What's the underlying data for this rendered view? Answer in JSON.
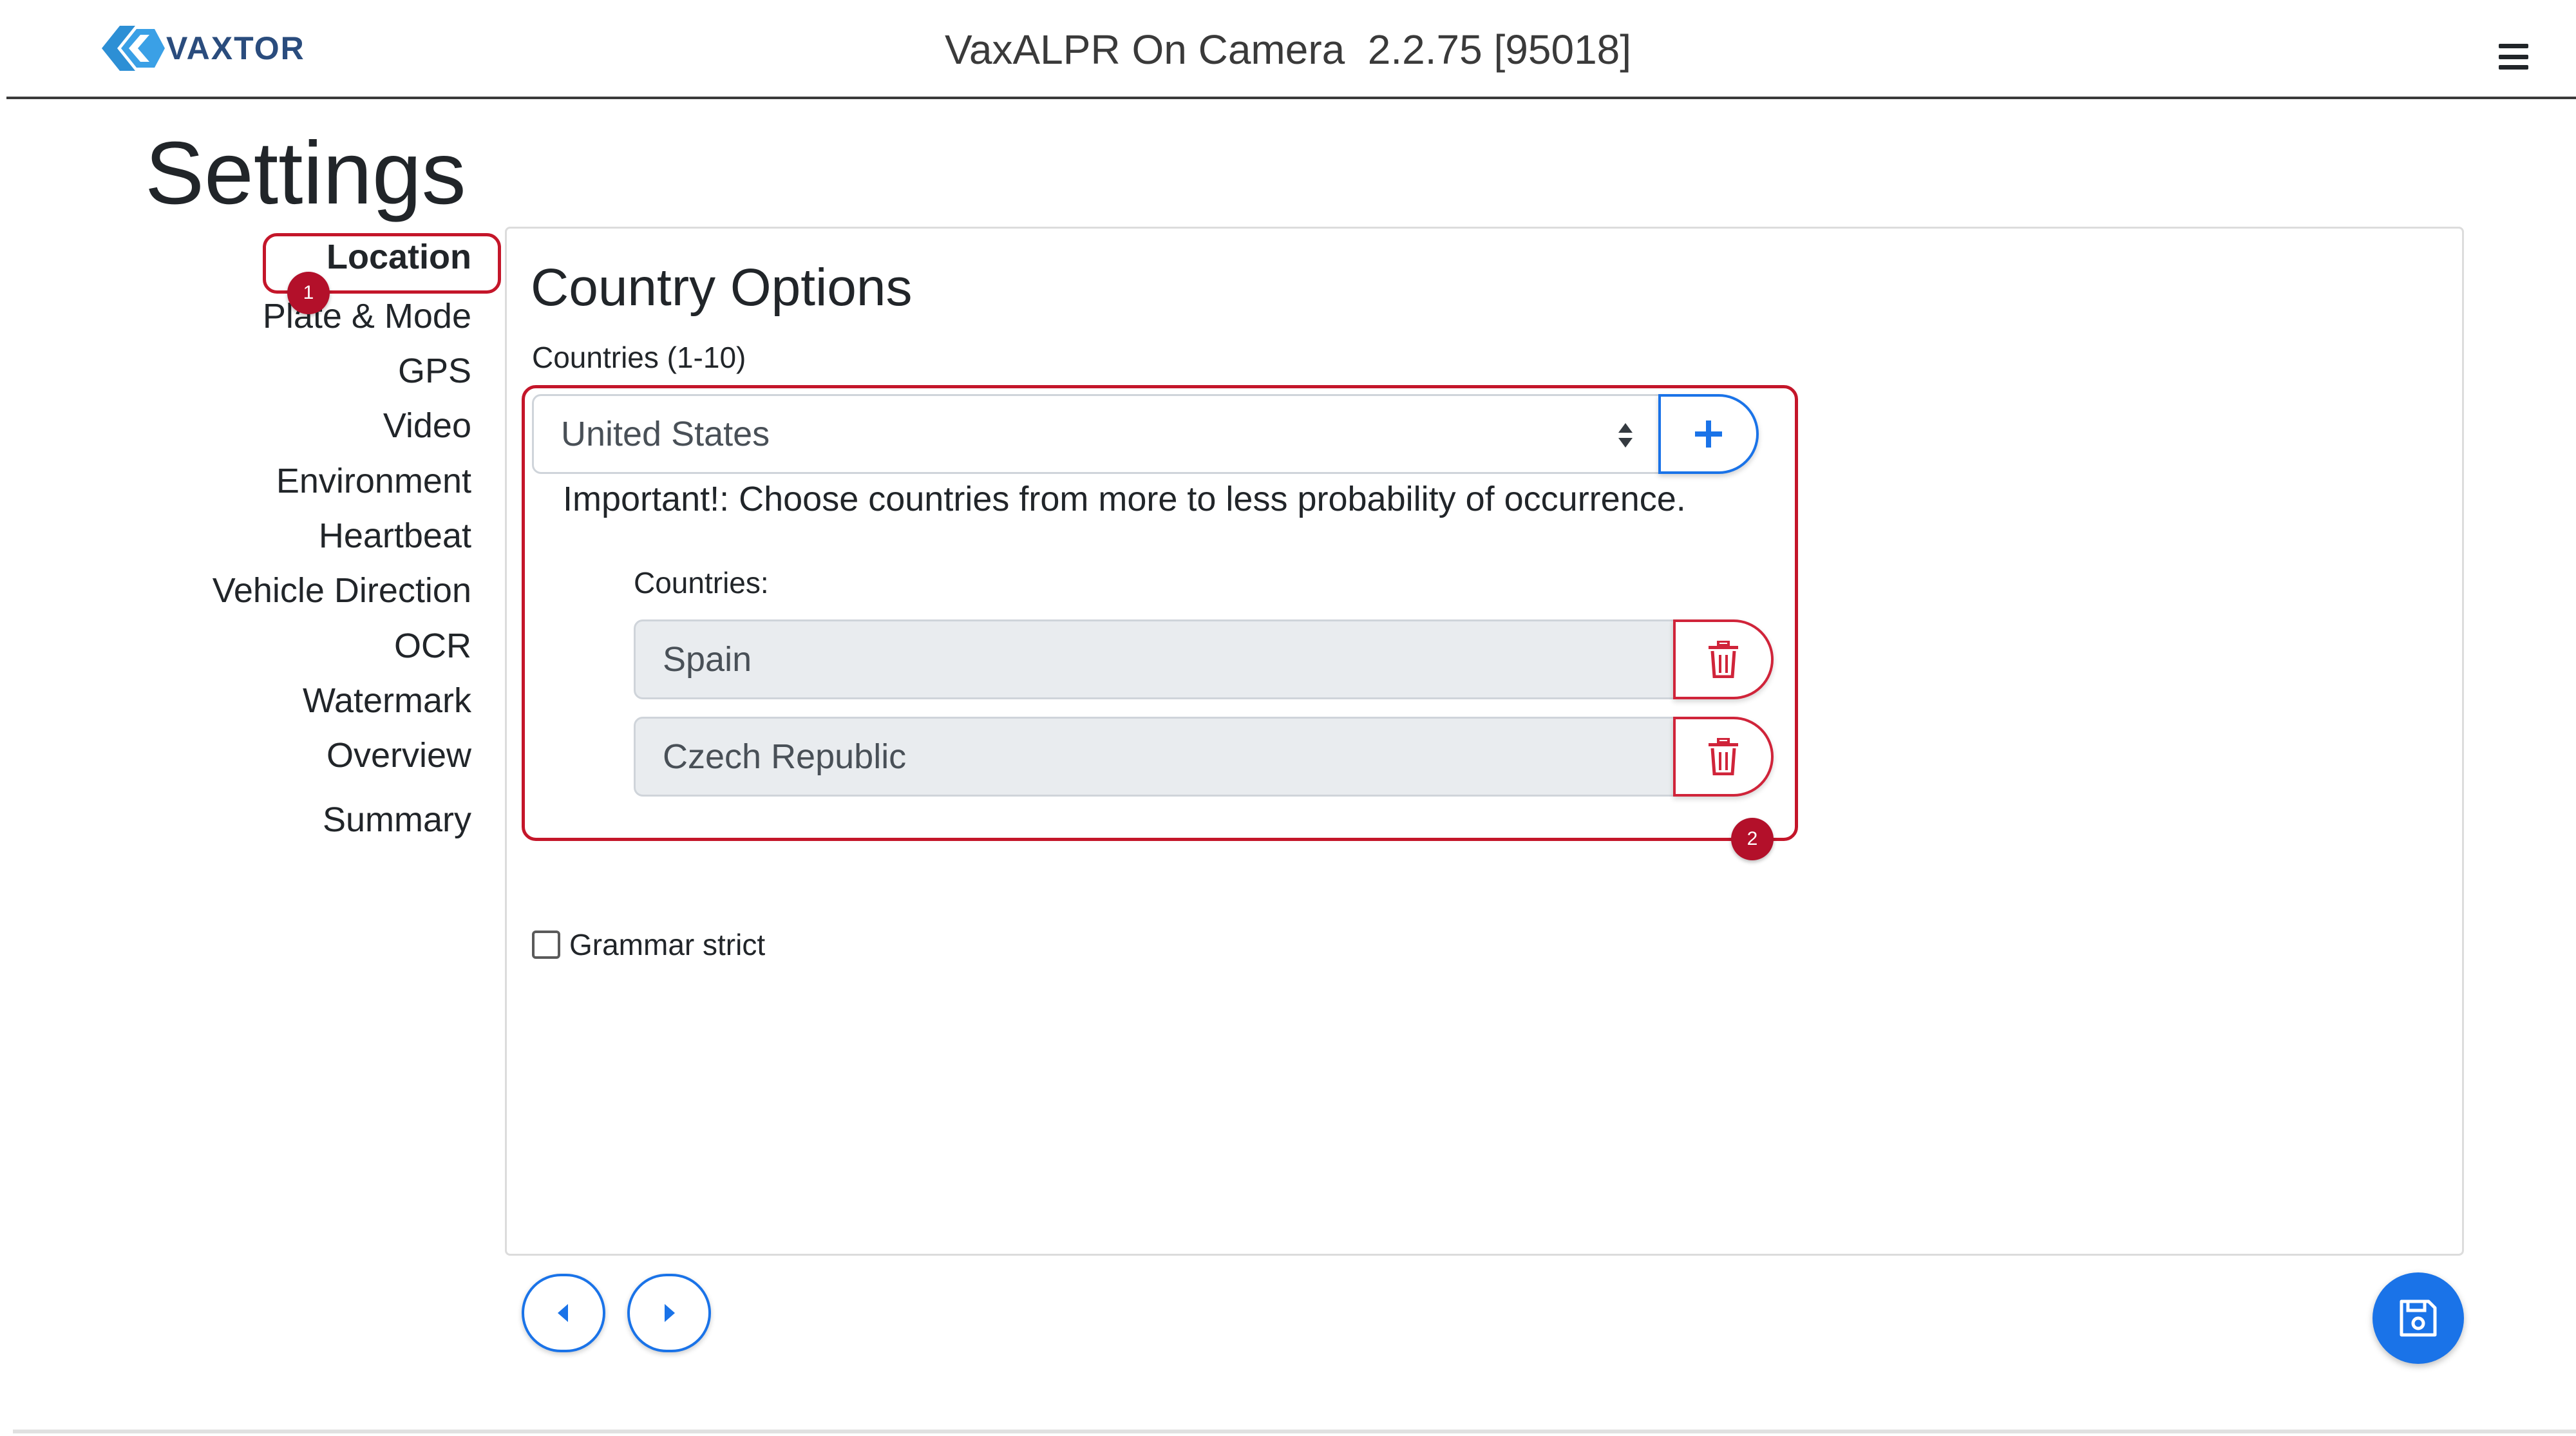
{
  "header": {
    "logo_text": "VAXTOR",
    "app_title": "VaxALPR On Camera",
    "version": "2.2.75 [95018]",
    "menu_icon": "hamburger-icon"
  },
  "page": {
    "title": "Settings"
  },
  "sidebar": {
    "items": [
      {
        "label": "Location",
        "active": true
      },
      {
        "label": "Plate & Mode"
      },
      {
        "label": "GPS"
      },
      {
        "label": "Video"
      },
      {
        "label": "Environment"
      },
      {
        "label": "Heartbeat"
      },
      {
        "label": "Vehicle Direction"
      },
      {
        "label": "OCR"
      },
      {
        "label": "Watermark"
      },
      {
        "label": "Overview"
      },
      {
        "label": "Summary"
      }
    ]
  },
  "annotations": {
    "marker_1": "1",
    "marker_2": "2",
    "color": "#c4162a"
  },
  "country_options": {
    "title": "Country Options",
    "countries_label": "Countries (1-10)",
    "selected_country": "United States",
    "important_note": "Important!: Choose countries from more to less probability of occurrence.",
    "list_label": "Countries:",
    "countries": [
      "Spain",
      "Czech Republic"
    ],
    "grammar_strict_label": "Grammar strict",
    "grammar_strict_checked": false
  },
  "colors": {
    "primary": "#1a73e8",
    "danger": "#d0243a",
    "logo": "#2a4c7d"
  }
}
